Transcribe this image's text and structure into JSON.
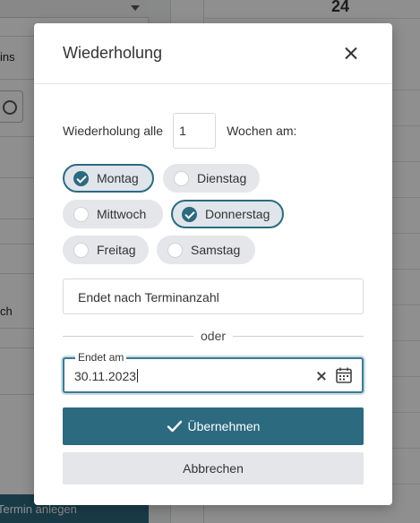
{
  "background": {
    "texts": [
      "ins",
      "ch"
    ],
    "create_appointment_label": "Termin anlegen",
    "day_number": "24"
  },
  "dialog": {
    "title": "Wiederholung",
    "interval": {
      "label": "Wiederholung alle",
      "value": "1",
      "suffix": "Wochen am:"
    },
    "weekdays": [
      {
        "label": "Montag",
        "selected": true
      },
      {
        "label": "Dienstag",
        "selected": false
      },
      {
        "label": "Mittwoch",
        "selected": false
      },
      {
        "label": "Donnerstag",
        "selected": true
      },
      {
        "label": "Freitag",
        "selected": false
      },
      {
        "label": "Samstag",
        "selected": false
      }
    ],
    "end_count_placeholder": "Endet nach Terminanzahl",
    "or_label": "oder",
    "end_date": {
      "label": "Endet am",
      "value": "30.11.2023"
    },
    "apply_label": "Übernehmen",
    "cancel_label": "Abbrechen"
  },
  "colors": {
    "primary": "#2c6a80",
    "chip_background": "#e4e6ea"
  },
  "icons": [
    "close-icon",
    "check-icon",
    "clear-icon",
    "calendar-icon",
    "clock-icon"
  ]
}
